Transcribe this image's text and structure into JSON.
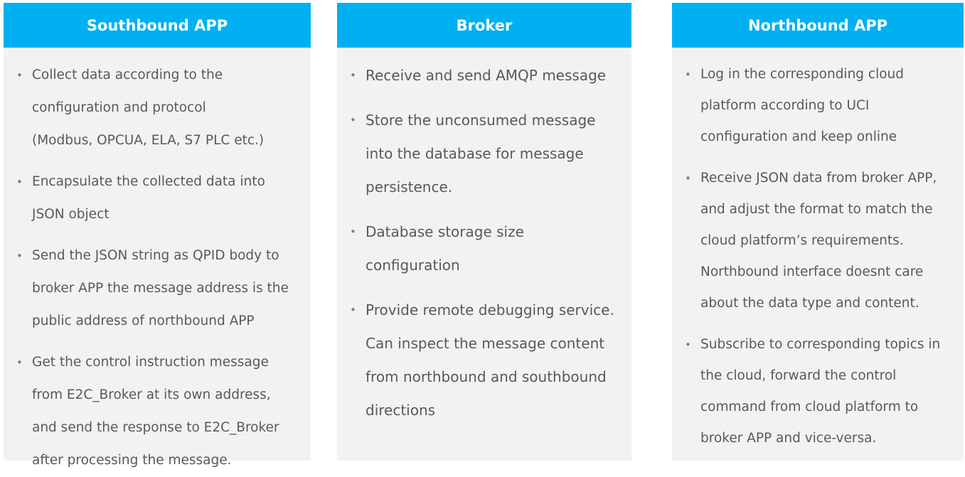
{
  "columns": [
    {
      "title": "Southbound APP",
      "bullets": [
        [
          "Collect data according to the",
          "configuration and protocol",
          "(Modbus, OPCUA, ELA, S7 PLC etc.)"
        ],
        [
          "Encapsulate the collected data into",
          "JSON object"
        ],
        [
          "Send the JSON string as QPID body to",
          "broker APP the message address is the",
          "public address of northbound APP"
        ],
        [
          "Get the control instruction message",
          "from E2C_Broker at its own address,",
          "and send the response to E2C_Broker",
          "after processing the message."
        ]
      ]
    },
    {
      "title": "Broker",
      "bullets": [
        [
          "Receive and send AMQP message"
        ],
        [
          "Store the unconsumed message",
          "into the database for message",
          "persistence."
        ],
        [
          "Database storage size",
          "configuration"
        ],
        [
          "Provide remote debugging service.",
          "Can inspect the message content",
          "from northbound and southbound",
          "directions"
        ]
      ]
    },
    {
      "title": "Northbound APP",
      "bullets": [
        [
          "Log in the corresponding cloud",
          "platform according to UCI",
          "configuration and keep online"
        ],
        [
          "Receive JSON data from broker APP,",
          "and adjust the format to match the",
          "cloud platform’s requirements.",
          "Northbound interface doesnt care",
          "about the data type and content."
        ],
        [
          "Subscribe to corresponding topics in",
          "the cloud, forward the control",
          "command from cloud platform to",
          "broker APP and vice-versa."
        ]
      ]
    }
  ],
  "bullet_symbol": "•",
  "colors": {
    "header_bg": "#00b0f0",
    "header_text": "#ffffff",
    "panel_bg": "#f2f2f2",
    "body_text": "#595959"
  }
}
